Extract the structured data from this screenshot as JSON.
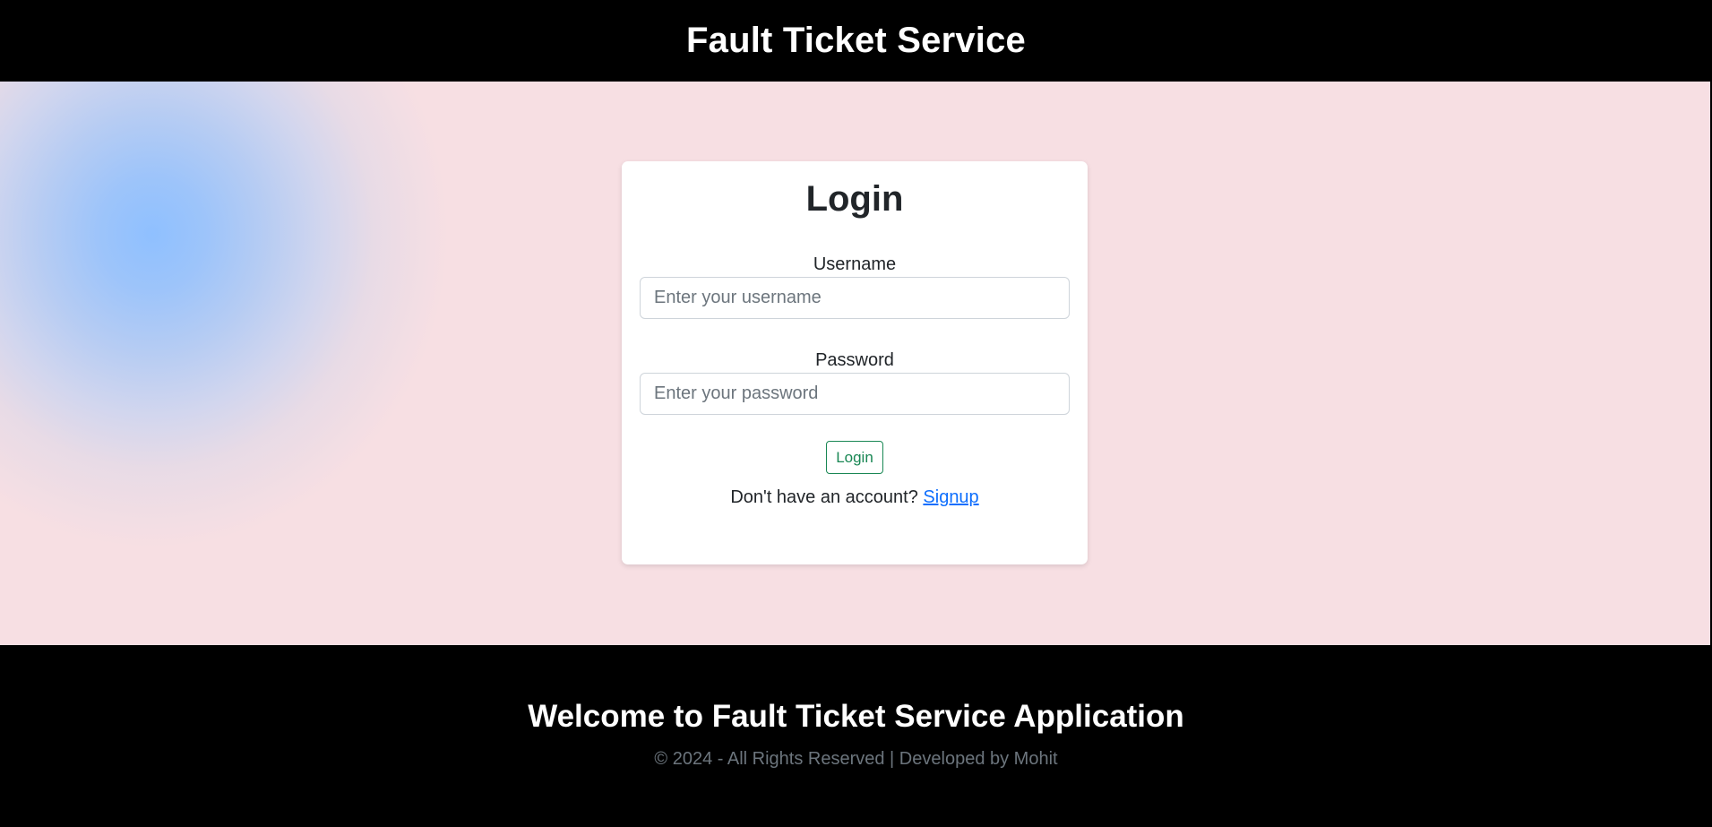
{
  "header": {
    "title": "Fault Ticket Service"
  },
  "login": {
    "title": "Login",
    "username_label": "Username",
    "username_placeholder": "Enter your username",
    "password_label": "Password",
    "password_placeholder": "Enter your password",
    "button_label": "Login",
    "signup_prompt": "Don't have an account?",
    "signup_link": "Signup"
  },
  "footer": {
    "title": "Welcome to Fault Ticket Service Application",
    "copyright": "© 2024 - All Rights Reserved | Developed by Mohit"
  },
  "colors": {
    "header_bg": "#000000",
    "page_bg": "#f7dfe3",
    "blob": "#8fc0ff",
    "button_outline": "#198754",
    "link": "#0d6efd",
    "footer_text_muted": "#6c757d"
  }
}
